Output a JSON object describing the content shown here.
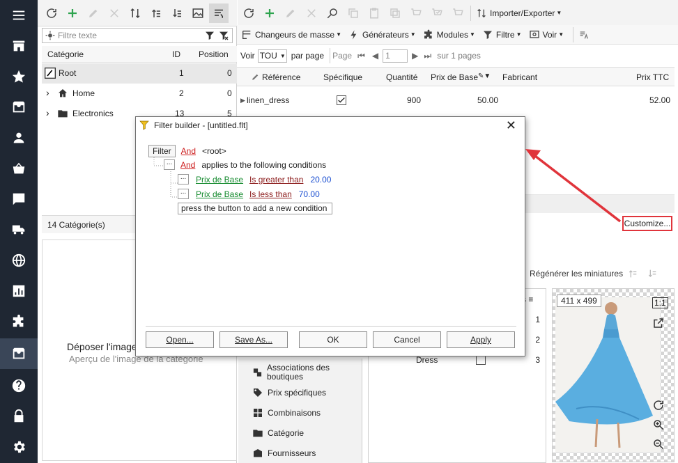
{
  "left": {
    "filter_placeholder": "Filtre texte",
    "columns": [
      "Catégorie",
      "ID",
      "Position"
    ],
    "rows": [
      {
        "name": "Root",
        "id": "1",
        "pos": "0"
      },
      {
        "name": "Home",
        "id": "2",
        "pos": "0"
      },
      {
        "name": "Electronics",
        "id": "13",
        "pos": "5"
      }
    ],
    "footer": "14 Catégorie(s)",
    "drop_text": "Déposer l'image",
    "drop_sub": "Aperçu de l'image de la catégorie"
  },
  "right": {
    "import_export": "Importer/Exporter",
    "menus": [
      "Changeurs de masse",
      "Générateurs",
      "Modules",
      "Filtre",
      "Voir"
    ],
    "pager": {
      "voir": "Voir",
      "count": "TOU",
      "per_page": "par page",
      "page": "Page",
      "page_value": "1",
      "of": "sur 1 pages"
    },
    "columns": [
      "Référence",
      "Spécifique",
      "Quantité",
      "Prix de Base",
      "Fabricant",
      "Prix TTC"
    ],
    "row": {
      "ref": "linen_dress",
      "qty": "900",
      "price": "50.00",
      "ttc": "52.00"
    },
    "customize": "Customize...",
    "regen": "Régénérer les miniatures",
    "bottom_left": [
      "Associations des boutiques",
      "Prix spécifiques",
      "Combinaisons",
      "Catégorie",
      "Fournisseurs"
    ],
    "bottom_mid_numbers": [
      "1",
      "2",
      "3"
    ],
    "bottom_mid_label": "Dress",
    "photo_size": "411 x 499"
  },
  "dialog": {
    "title": "Filter builder - [untitled.flt]",
    "filter_btn": "Filter",
    "and1": "And",
    "root": "<root>",
    "and2": "And",
    "applies": "applies to the following conditions",
    "cond1": {
      "field": "Prix de Base",
      "op": "Is greater than",
      "value": "20.00"
    },
    "cond2": {
      "field": "Prix de Base",
      "op": "Is less than",
      "value": "70.00"
    },
    "add_hint": "press the button to add a new condition",
    "dots": "...",
    "buttons": [
      "Open...",
      "Save As...",
      "OK",
      "Cancel",
      "Apply"
    ]
  }
}
